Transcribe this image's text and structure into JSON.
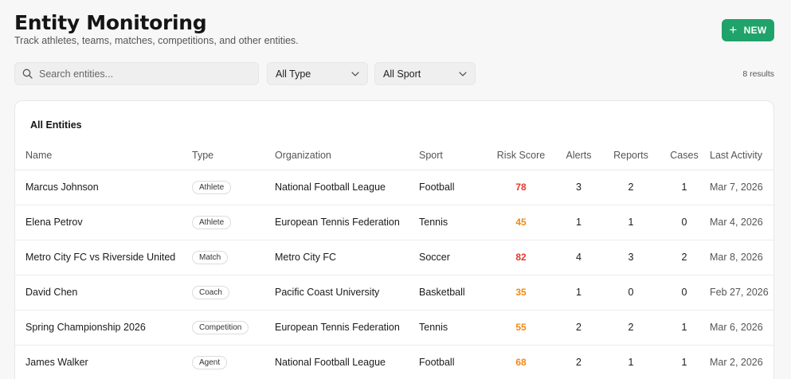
{
  "header": {
    "title": "Entity Monitoring",
    "subtitle": "Track athletes, teams, matches, competitions, and other entities.",
    "new_label": "NEW"
  },
  "filters": {
    "search_placeholder": "Search entities...",
    "type_value": "All Type",
    "sport_value": "All Sport",
    "results": "8 results"
  },
  "table": {
    "title": "All Entities",
    "columns": [
      "Name",
      "Type",
      "Organization",
      "Sport",
      "Risk Score",
      "Alerts",
      "Reports",
      "Cases",
      "Last Activity"
    ],
    "rows": [
      {
        "name": "Marcus Johnson",
        "type": "Athlete",
        "org": "National Football League",
        "sport": "Football",
        "risk": "78",
        "alerts": "3",
        "reports": "2",
        "cases": "1",
        "activity": "Mar 7, 2026"
      },
      {
        "name": "Elena Petrov",
        "type": "Athlete",
        "org": "European Tennis Federation",
        "sport": "Tennis",
        "risk": "45",
        "alerts": "1",
        "reports": "1",
        "cases": "0",
        "activity": "Mar 4, 2026"
      },
      {
        "name": "Metro City FC vs Riverside United",
        "type": "Match",
        "org": "Metro City FC",
        "sport": "Soccer",
        "risk": "82",
        "alerts": "4",
        "reports": "3",
        "cases": "2",
        "activity": "Mar 8, 2026"
      },
      {
        "name": "David Chen",
        "type": "Coach",
        "org": "Pacific Coast University",
        "sport": "Basketball",
        "risk": "35",
        "alerts": "1",
        "reports": "0",
        "cases": "0",
        "activity": "Feb 27, 2026"
      },
      {
        "name": "Spring Championship 2026",
        "type": "Competition",
        "org": "European Tennis Federation",
        "sport": "Tennis",
        "risk": "55",
        "alerts": "2",
        "reports": "2",
        "cases": "1",
        "activity": "Mar 6, 2026"
      },
      {
        "name": "James Walker",
        "type": "Agent",
        "org": "National Football League",
        "sport": "Football",
        "risk": "68",
        "alerts": "2",
        "reports": "1",
        "cases": "1",
        "activity": "Mar 2, 2026"
      }
    ]
  },
  "colors": {
    "accent": "#1fa36a",
    "risk_high": "#e0392b",
    "risk_medium": "#ef8a17"
  }
}
